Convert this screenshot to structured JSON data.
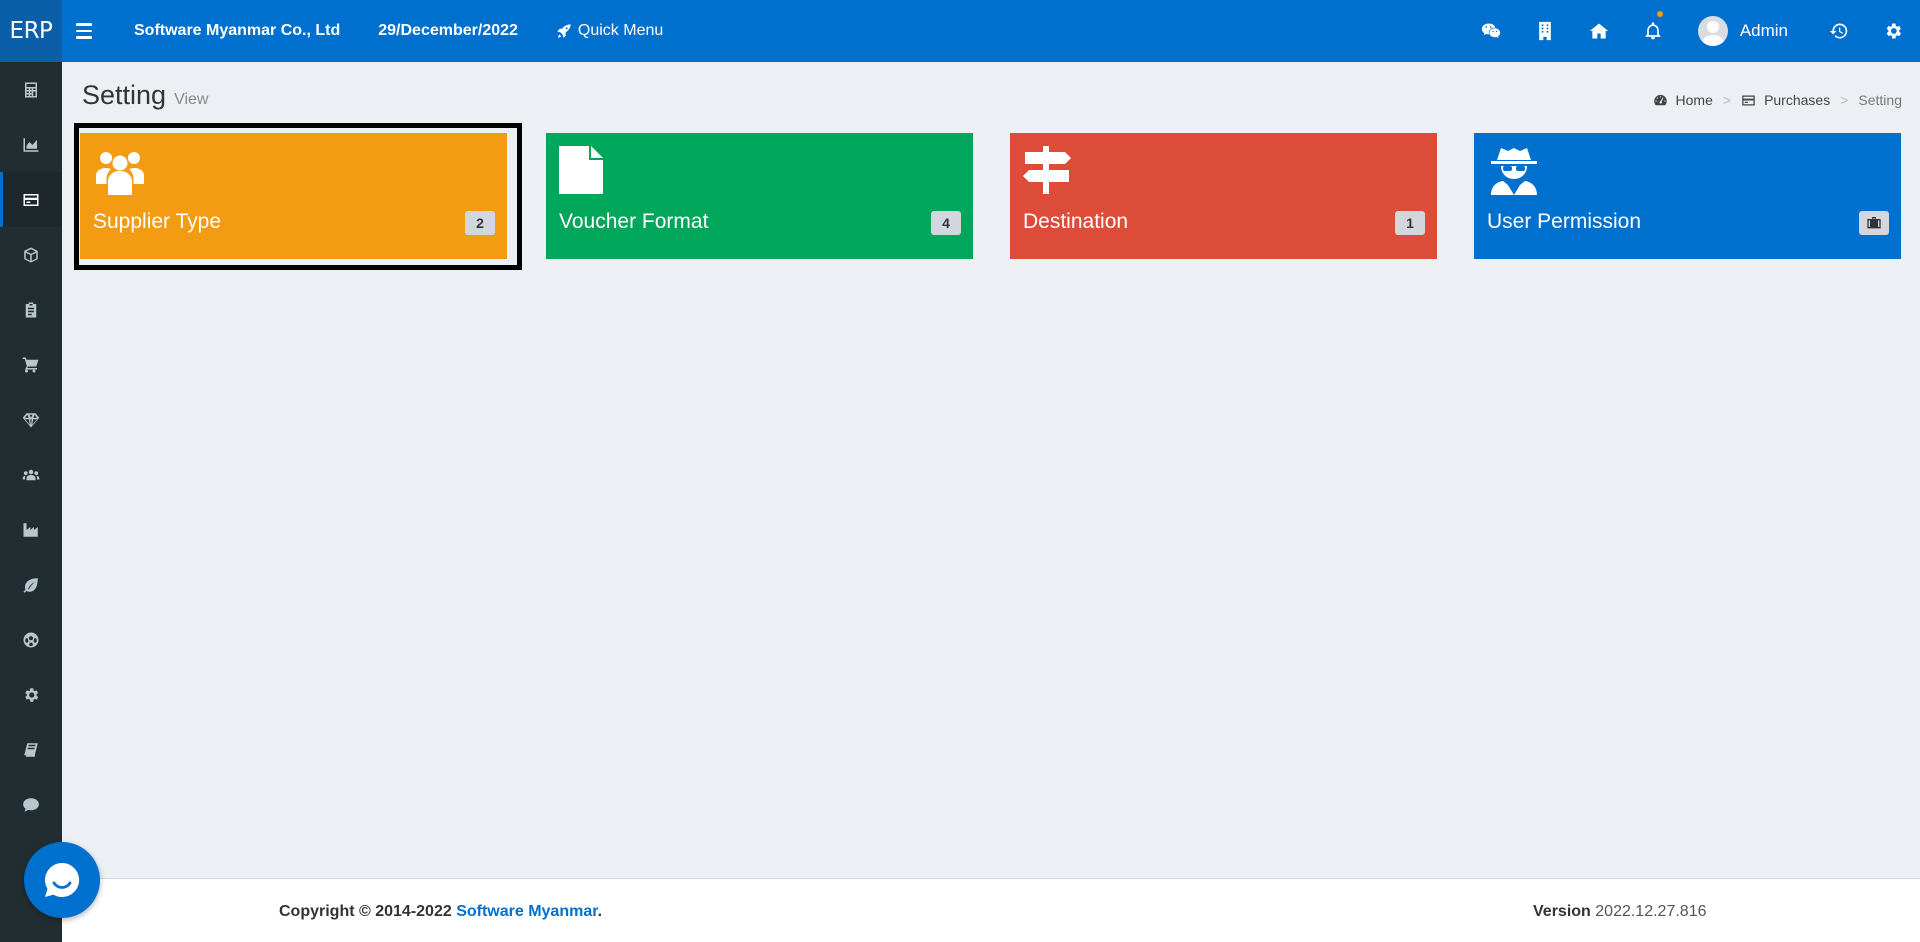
{
  "app": {
    "logo": "ERP",
    "company": "Software Myanmar Co., Ltd",
    "date": "29/December/2022",
    "quick_menu": "Quick Menu",
    "user_name": "Admin",
    "brand_color": "#0070ce"
  },
  "topbar_icons": [
    "wechat-icon",
    "building-icon",
    "home-icon",
    "bell-icon",
    "history-icon",
    "gear-icon"
  ],
  "sidebar": {
    "items": [
      {
        "icon": "calculator-icon"
      },
      {
        "icon": "area-chart-icon"
      },
      {
        "icon": "credit-card-icon",
        "active": true
      },
      {
        "icon": "cube-icon"
      },
      {
        "icon": "clipboard-icon"
      },
      {
        "icon": "cart-icon"
      },
      {
        "icon": "diamond-icon"
      },
      {
        "icon": "users-icon"
      },
      {
        "icon": "industry-icon"
      },
      {
        "icon": "leaf-icon"
      },
      {
        "icon": "soccer-ball-icon"
      },
      {
        "icon": "gear-icon"
      },
      {
        "icon": "book-icon"
      },
      {
        "icon": "comment-icon"
      }
    ]
  },
  "page": {
    "title": "Setting",
    "subtitle": "View"
  },
  "breadcrumb": {
    "home": "Home",
    "purchases": "Purchases",
    "current": "Setting",
    "separator": ">"
  },
  "tiles": [
    {
      "label": "Supplier Type",
      "count": "2",
      "color": "#f39c12",
      "icon": "users-icon",
      "selected": true
    },
    {
      "label": "Voucher Format",
      "count": "4",
      "color": "#00a65a",
      "icon": "file-icon"
    },
    {
      "label": "Destination",
      "count": "1",
      "color": "#dd4b39",
      "icon": "signpost-icon"
    },
    {
      "label": "User Permission",
      "count": "",
      "color": "#0070ce",
      "icon": "user-secret-icon",
      "badge_icon": "briefcase-icon"
    }
  ],
  "footer": {
    "copyright_prefix": "Copyright © 2014-2022 ",
    "copyright_link": "Software Myanmar",
    "copyright_suffix": ".",
    "version_label": "Version",
    "version_number": "2022.12.27.816"
  }
}
